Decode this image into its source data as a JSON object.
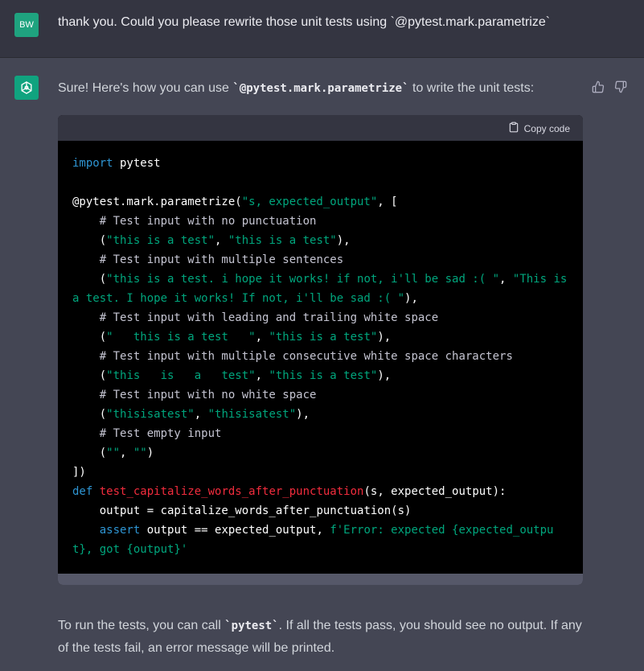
{
  "user_message": {
    "avatar_initials": "BW",
    "text": "thank you. Could you please rewrite those unit tests using `@pytest.mark.parametrize`"
  },
  "assistant_message": {
    "intro_before": "Sure! Here's how you can use ",
    "intro_code": "`@pytest.mark.parametrize`",
    "intro_after": " to write the unit tests:",
    "code_block": {
      "copy_label": "Copy code",
      "lines": [
        [
          {
            "t": "import",
            "c": "kw"
          },
          {
            "t": " pytest"
          }
        ],
        [],
        [
          {
            "t": "@pytest.mark.parametrize("
          },
          {
            "t": "\"s, expected_output\"",
            "c": "st"
          },
          {
            "t": ", ["
          }
        ],
        [
          {
            "t": "    # Test input with no punctuation",
            "c": "cm"
          }
        ],
        [
          {
            "t": "    ("
          },
          {
            "t": "\"this is a test\"",
            "c": "st"
          },
          {
            "t": ", "
          },
          {
            "t": "\"this is a test\"",
            "c": "st"
          },
          {
            "t": "),"
          }
        ],
        [
          {
            "t": "    # Test input with multiple sentences",
            "c": "cm"
          }
        ],
        [
          {
            "t": "    ("
          },
          {
            "t": "\"this is a test. i hope it works! if not, i'll be sad :( \"",
            "c": "st"
          },
          {
            "t": ", "
          },
          {
            "t": "\"This is a test. I hope it works! If not, i'll be sad :( \"",
            "c": "st"
          },
          {
            "t": "),"
          }
        ],
        [
          {
            "t": "    # Test input with leading and trailing white space",
            "c": "cm"
          }
        ],
        [
          {
            "t": "    ("
          },
          {
            "t": "\"   this is a test   \"",
            "c": "st"
          },
          {
            "t": ", "
          },
          {
            "t": "\"this is a test\"",
            "c": "st"
          },
          {
            "t": "),"
          }
        ],
        [
          {
            "t": "    # Test input with multiple consecutive white space characters",
            "c": "cm"
          }
        ],
        [
          {
            "t": "    ("
          },
          {
            "t": "\"this   is   a   test\"",
            "c": "st"
          },
          {
            "t": ", "
          },
          {
            "t": "\"this is a test\"",
            "c": "st"
          },
          {
            "t": "),"
          }
        ],
        [
          {
            "t": "    # Test input with no white space",
            "c": "cm"
          }
        ],
        [
          {
            "t": "    ("
          },
          {
            "t": "\"thisisatest\"",
            "c": "st"
          },
          {
            "t": ", "
          },
          {
            "t": "\"thisisatest\"",
            "c": "st"
          },
          {
            "t": "),"
          }
        ],
        [
          {
            "t": "    # Test empty input",
            "c": "cm"
          }
        ],
        [
          {
            "t": "    ("
          },
          {
            "t": "\"\"",
            "c": "st"
          },
          {
            "t": ", "
          },
          {
            "t": "\"\"",
            "c": "st"
          },
          {
            "t": ")"
          }
        ],
        [
          {
            "t": "])"
          }
        ],
        [
          {
            "t": "def",
            "c": "kw"
          },
          {
            "t": " "
          },
          {
            "t": "test_capitalize_words_after_punctuation",
            "c": "fn"
          },
          {
            "t": "(s, expected_output):"
          }
        ],
        [
          {
            "t": "    output = capitalize_words_after_punctuation(s)"
          }
        ],
        [
          {
            "t": "    "
          },
          {
            "t": "assert",
            "c": "kw"
          },
          {
            "t": " output == expected_output, "
          },
          {
            "t": "f'Error: expected {expected_output}, got {output}'",
            "c": "st"
          }
        ]
      ]
    },
    "outro_before": "To run the tests, you can call ",
    "outro_code": "`pytest`",
    "outro_after": ". If all the tests pass, you should see no output. If any of the tests fail, an error message will be printed."
  },
  "icons": {
    "assistant_logo": "openai-logo-icon",
    "thumbs_up": "thumbs-up-icon",
    "thumbs_down": "thumbs-down-icon",
    "copy": "clipboard-icon"
  },
  "colors": {
    "user_bg": "#343541",
    "assistant_bg": "#444654",
    "accent": "#10a37f",
    "keyword": "#2e95d3",
    "string": "#00a67d",
    "function": "#f22c3d"
  }
}
